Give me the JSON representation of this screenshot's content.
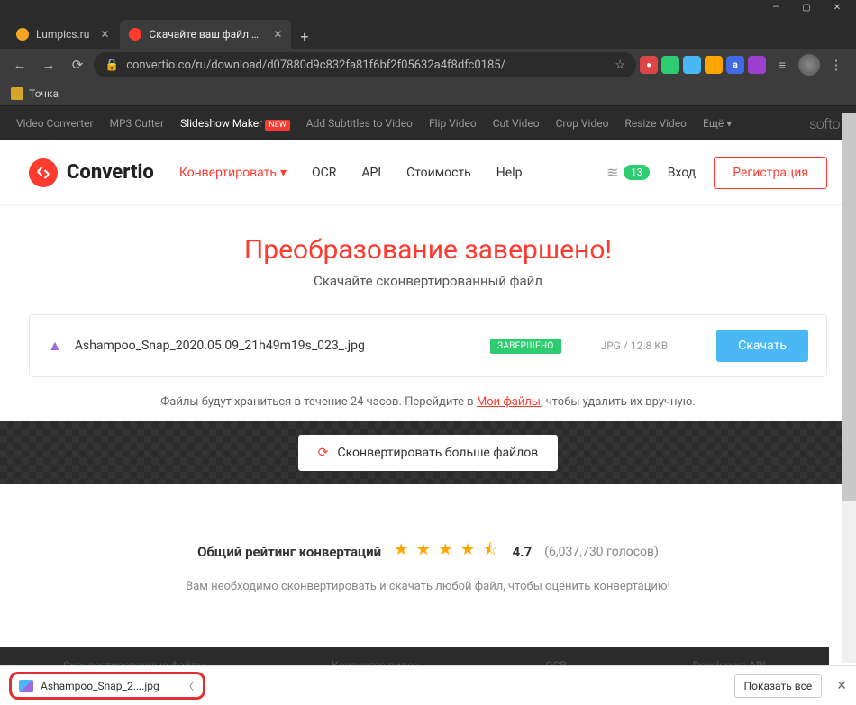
{
  "window": {
    "min": "—",
    "max": "▢",
    "close": "✕"
  },
  "tabs": [
    {
      "title": "Lumpics.ru",
      "favicon_color": "#f5a623",
      "active": false
    },
    {
      "title": "Скачайте ваш файл — Convertio",
      "favicon_color": "#ff3b30",
      "active": true
    }
  ],
  "newtab": "+",
  "nav": {
    "back": "←",
    "fwd": "→",
    "reload": "⟳"
  },
  "address": {
    "lock": "🔒",
    "url": "convertio.co/ru/download/d07880d9c832fa81f6bf2f05632a4f8dfc0185/",
    "star": "☆"
  },
  "extensions": [
    {
      "bg": "#2ecc71",
      "txt": ""
    },
    {
      "bg": "#4ab8f5",
      "txt": ""
    },
    {
      "bg": "#ffa500",
      "txt": ""
    },
    {
      "bg": "#4169e1",
      "txt": ""
    },
    {
      "bg": "#9c3fcf",
      "txt": ""
    }
  ],
  "bookmark": {
    "label": "Точка"
  },
  "topnav": {
    "items": [
      "Video Converter",
      "MP3 Cutter",
      "Slideshow Maker",
      "Add Subtitles to Video",
      "Flip Video",
      "Cut Video",
      "Crop Video",
      "Resize Video",
      "Ещё"
    ],
    "highlight_index": 2,
    "new_index": 2,
    "brand": "softo"
  },
  "header": {
    "logo": "Convertio",
    "convert": "Конвертировать",
    "links": [
      "OCR",
      "API",
      "Стоимость",
      "Help"
    ],
    "badge": "13",
    "login": "Вход",
    "signup": "Регистрация"
  },
  "hero": {
    "title": "Преобразование завершено!",
    "sub": "Скачайте сконвертированный файл"
  },
  "file": {
    "name": "Ashampoo_Snap_2020.05.09_21h49m19s_023_.jpg",
    "status": "ЗАВЕРШЕНО",
    "info": "JPG / 12.8 KB",
    "download": "Скачать"
  },
  "note": {
    "before": "Файлы будут храниться в течение 24 часов. Перейдите в ",
    "link": "Мои файлы",
    "after": ", чтобы удалить их вручную."
  },
  "more": "Сконвертировать больше файлов",
  "rating": {
    "label": "Общий рейтинг конвертаций",
    "score": "4.7",
    "count": "(6,037,730 голосов)",
    "sub": "Вам необходимо сконвертировать и скачать любой файл, чтобы оценить конвертацию!"
  },
  "footer_links": [
    "Сконвертированные файлы",
    "Конвертор видео",
    "OCR",
    "Developers API"
  ],
  "download_bar": {
    "filename": "Ashampoo_Snap_2....jpg",
    "show_all": "Показать все"
  }
}
